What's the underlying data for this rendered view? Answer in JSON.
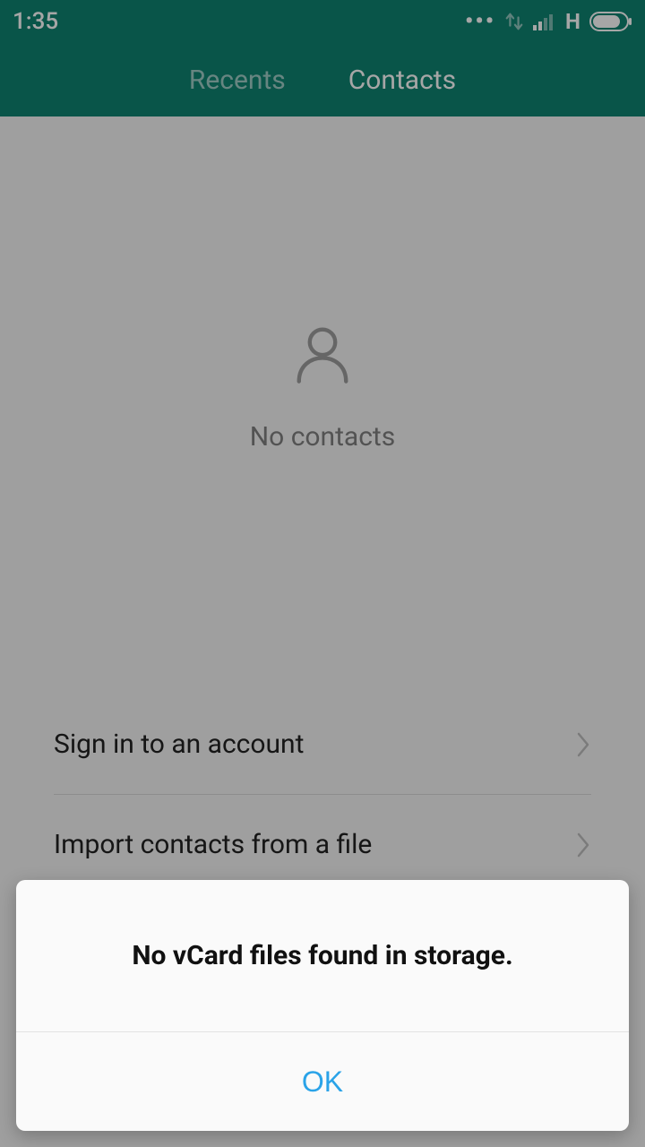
{
  "statusbar": {
    "time": "1:35",
    "dots": "•••",
    "network_label": "H"
  },
  "tabs": {
    "recents": "Recents",
    "contacts": "Contacts"
  },
  "empty": {
    "label": "No contacts"
  },
  "options": {
    "signin": "Sign in to an account",
    "import": "Import contacts from a file"
  },
  "dialog": {
    "message": "No vCard files found in storage.",
    "ok": "OK"
  }
}
